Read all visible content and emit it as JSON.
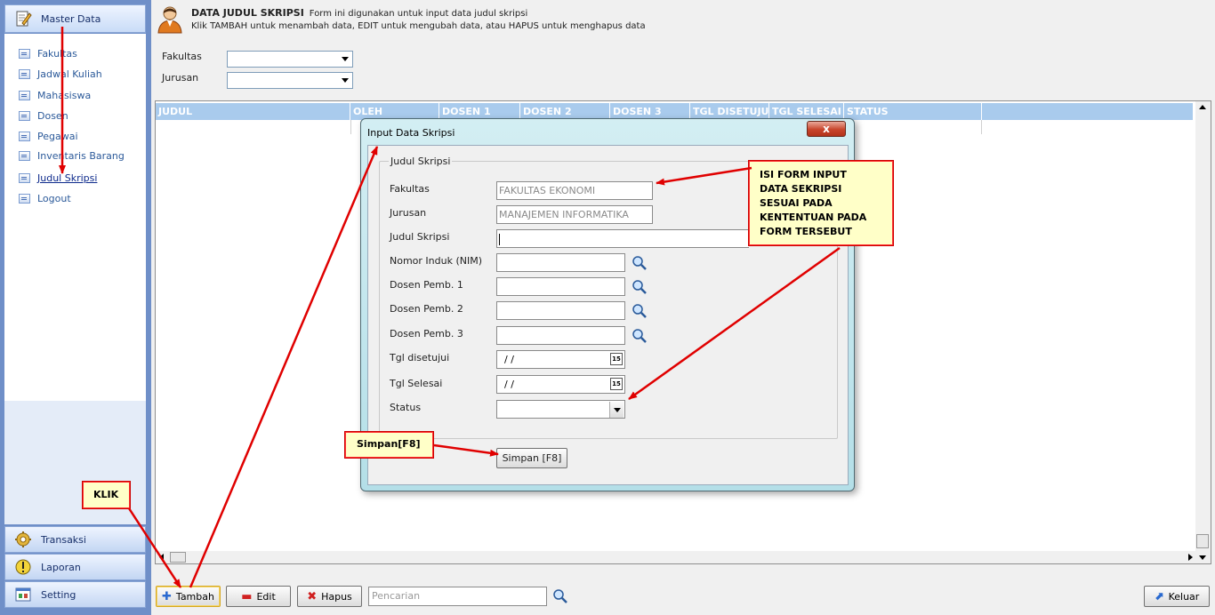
{
  "sidebar": {
    "header": "Master Data",
    "items": [
      {
        "label": "Fakultas"
      },
      {
        "label": "Jadwal Kuliah"
      },
      {
        "label": "Mahasiswa"
      },
      {
        "label": "Dosen"
      },
      {
        "label": "Pegawai"
      },
      {
        "label": "Inventaris Barang"
      },
      {
        "label": "Judul Skripsi"
      },
      {
        "label": "Logout"
      }
    ],
    "sections": [
      {
        "label": "Transaksi"
      },
      {
        "label": "Laporan"
      },
      {
        "label": "Setting"
      }
    ]
  },
  "header": {
    "title": "DATA JUDUL SKRIPSI",
    "subtitle": "Form ini digunakan untuk input data judul skripsi",
    "instructions": "Klik TAMBAH untuk menambah data, EDIT untuk mengubah data, atau HAPUS untuk menghapus data"
  },
  "filters": {
    "fakultas_label": "Fakultas",
    "fakultas_value": "",
    "jurusan_label": "Jurusan",
    "jurusan_value": ""
  },
  "grid": {
    "columns": [
      "JUDUL",
      "OLEH",
      "DOSEN 1",
      "DOSEN 2",
      "DOSEN 3",
      "TGL DISETUJUI",
      "TGL SELESAI",
      "STATUS"
    ]
  },
  "toolbar": {
    "tambah": "Tambah",
    "edit": "Edit",
    "hapus": "Hapus",
    "search_placeholder": "Pencarian",
    "keluar": "Keluar"
  },
  "dialog": {
    "title": "Input Data Skripsi",
    "close": "x",
    "group_title": "Judul Skripsi",
    "fields": {
      "fakultas_label": "Fakultas",
      "fakultas_value": "FAKULTAS EKONOMI",
      "jurusan_label": "Jurusan",
      "jurusan_value": "MANAJEMEN INFORMATIKA",
      "judul_label": "Judul Skripsi",
      "judul_value": "",
      "nim_label": "Nomor Induk (NIM)",
      "dosen1_label": "Dosen Pemb. 1",
      "dosen2_label": "Dosen Pemb. 2",
      "dosen3_label": "Dosen Pemb. 3",
      "tgl_setuju_label": "Tgl disetujui",
      "tgl_setuju_value": "/ /",
      "tgl_selesai_label": "Tgl Selesai",
      "tgl_selesai_value": "/ /",
      "status_label": "Status",
      "status_value": "",
      "date_icon": "15"
    },
    "simpan": "Simpan [F8]"
  },
  "annotations": {
    "isi_form_lines": [
      "ISI FORM INPUT",
      "DATA SEKRIPSI",
      "SESUAI PADA",
      "KENTENTUAN PADA",
      "FORM TERSEBUT"
    ],
    "simpan_note": "Simpan[F8]",
    "klik": "KLIK",
    "color": "#e00000"
  }
}
